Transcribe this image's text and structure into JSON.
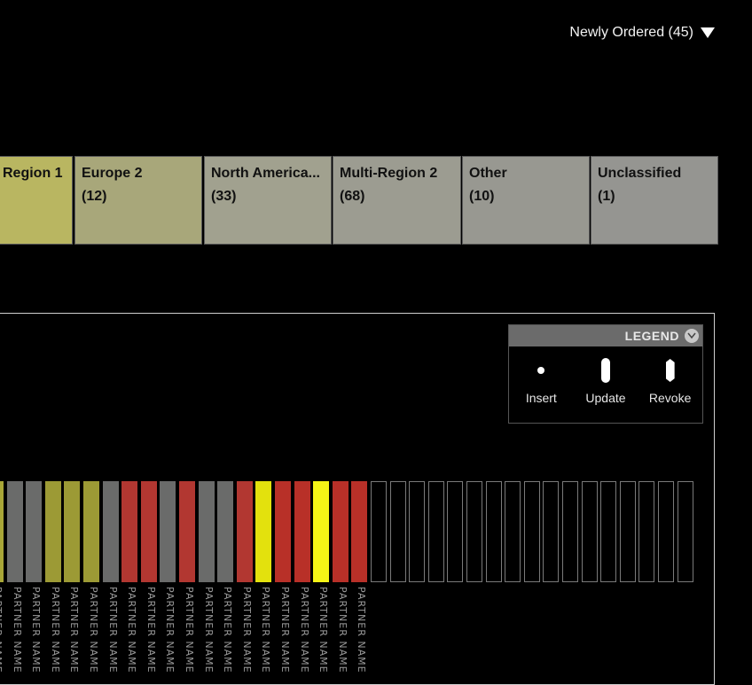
{
  "filter": {
    "label": "Newly Ordered (45)"
  },
  "regions": [
    {
      "name": "Region 1",
      "count": "",
      "color": "#b9b661"
    },
    {
      "name": "Europe 2",
      "count": "(12)",
      "color": "#a8a77a"
    },
    {
      "name": "North America...",
      "count": "(33)",
      "color": "#a1a18f"
    },
    {
      "name": "Multi-Region 2",
      "count": "(68)",
      "color": "#9c9c91"
    },
    {
      "name": "Other",
      "count": "(10)",
      "color": "#989891"
    },
    {
      "name": "Unclassified",
      "count": "(1)",
      "color": "#959591"
    }
  ],
  "legend": {
    "title": "LEGEND",
    "items": [
      {
        "label": "Insert",
        "icon": "dot-icon"
      },
      {
        "label": "Update",
        "icon": "pill-icon"
      },
      {
        "label": "Revoke",
        "icon": "hexagon-icon"
      }
    ]
  },
  "bars": {
    "colors": [
      "#a9a737",
      "#6a6b6a",
      "#6a6b6a",
      "#9c9a35",
      "#9c9a35",
      "#9c9a35",
      "#6a6b6a",
      "#b23731",
      "#b23731",
      "#6a6b6a",
      "#b23731",
      "#6a6b6a",
      "#6a6b6a",
      "#b23731",
      "#e3e10d",
      "#b83028",
      "#b83028",
      "#f6f416",
      "#b83028",
      "#b83028",
      "",
      "",
      "",
      "",
      "",
      "",
      "",
      "",
      "",
      "",
      "",
      "",
      "",
      "",
      "",
      "",
      ""
    ],
    "label": "PARTNER NAME"
  }
}
